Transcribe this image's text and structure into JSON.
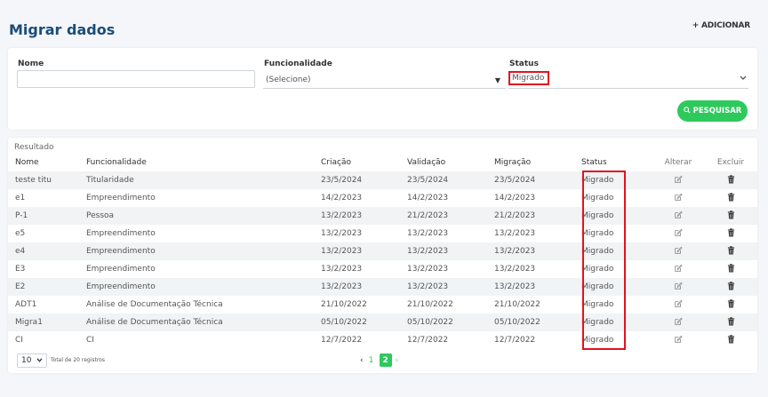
{
  "page": {
    "title": "Migrar dados",
    "add_label": "+ ADICIONAR"
  },
  "filters": {
    "nome_label": "Nome",
    "nome_value": "",
    "func_label": "Funcionalidade",
    "func_value": "(Selecione)",
    "status_label": "Status",
    "status_value": "Migrado",
    "search_label": "PESQUISAR"
  },
  "results": {
    "label": "Resultado",
    "headers": [
      "Nome",
      "Funcionalidade",
      "Criação",
      "Validação",
      "Migração",
      "Status",
      "Alterar",
      "Excluir"
    ],
    "rows": [
      {
        "nome": "teste titu",
        "func": "Titularidade",
        "criacao": "23/5/2024",
        "validacao": "23/5/2024",
        "migracao": "23/5/2024",
        "status": "Migrado"
      },
      {
        "nome": "e1",
        "func": "Empreendimento",
        "criacao": "14/2/2023",
        "validacao": "14/2/2023",
        "migracao": "14/2/2023",
        "status": "Migrado"
      },
      {
        "nome": "P-1",
        "func": "Pessoa",
        "criacao": "13/2/2023",
        "validacao": "21/2/2023",
        "migracao": "21/2/2023",
        "status": "Migrado"
      },
      {
        "nome": "e5",
        "func": "Empreendimento",
        "criacao": "13/2/2023",
        "validacao": "13/2/2023",
        "migracao": "13/2/2023",
        "status": "Migrado"
      },
      {
        "nome": "e4",
        "func": "Empreendimento",
        "criacao": "13/2/2023",
        "validacao": "13/2/2023",
        "migracao": "13/2/2023",
        "status": "Migrado"
      },
      {
        "nome": "E3",
        "func": "Empreendimento",
        "criacao": "13/2/2023",
        "validacao": "13/2/2023",
        "migracao": "13/2/2023",
        "status": "Migrado"
      },
      {
        "nome": "E2",
        "func": "Empreendimento",
        "criacao": "13/2/2023",
        "validacao": "13/2/2023",
        "migracao": "13/2/2023",
        "status": "Migrado"
      },
      {
        "nome": "ADT1",
        "func": "Análise de Documentação Técnica",
        "criacao": "21/10/2022",
        "validacao": "21/10/2022",
        "migracao": "21/10/2022",
        "status": "Migrado"
      },
      {
        "nome": "Migra1",
        "func": "Análise de Documentação Técnica",
        "criacao": "05/10/2022",
        "validacao": "05/10/2022",
        "migracao": "05/10/2022",
        "status": "Migrado"
      },
      {
        "nome": "CI",
        "func": "CI",
        "criacao": "12/7/2022",
        "validacao": "12/7/2022",
        "migracao": "12/7/2022",
        "status": "Migrado"
      }
    ]
  },
  "pagination": {
    "page_size": "10",
    "total_text": "Total de 20 registros",
    "prev": "‹",
    "page1": "1",
    "page2": "2",
    "next": "›"
  },
  "colors": {
    "accent": "#2ec95c",
    "title": "#1b4d78",
    "highlight": "#e0141e"
  },
  "icons": {
    "edit": "edit-icon",
    "delete": "trash-icon",
    "search": "search-icon",
    "dropdown": "chevron-down-icon"
  }
}
